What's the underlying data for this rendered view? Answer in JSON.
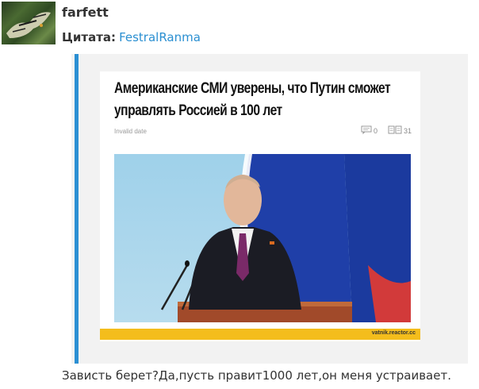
{
  "post": {
    "username": "farfett",
    "quote_label": "Цитата:",
    "quote_author": "FestralRanma",
    "comment_text": "Зависть берет?Да,пусть правит1000 лет,он меня устраивает."
  },
  "article": {
    "headline_line1": "Американские СМИ уверены, что Путин сможет",
    "headline_line2": "управлять Россией в 100 лет",
    "date": "Invalid date",
    "comments_count": "0",
    "views_count": "31",
    "source": "vatnik.reactor.cc"
  },
  "icons": {
    "comments": "comment-bubble-icon",
    "views": "views-icon"
  },
  "colors": {
    "quote_bar": "#2b8fd3",
    "author_link": "#2a8fd1",
    "footer_strip": "#f4bd1c"
  }
}
